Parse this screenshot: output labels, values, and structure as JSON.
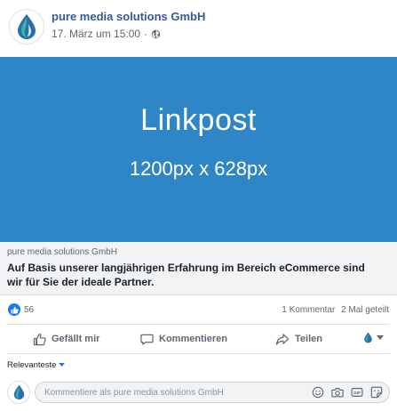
{
  "post": {
    "page_name": "pure media solutions GmbH",
    "timestamp": "17. März um 15:00",
    "privacy_icon": "globe-icon",
    "dot": "·"
  },
  "link_preview": {
    "image_title": "Linkpost",
    "image_size": "1200px x 628px",
    "image_color": "#2f86c6",
    "domain": "pure media solutions GmbH",
    "headline": "Auf Basis unserer langjährigen Erfahrung im Bereich eCommerce sind wir für Sie der ideale Partner."
  },
  "reactions": {
    "like_count": "56",
    "comments": "1 Kommentar",
    "shares": "2 Mal geteilt"
  },
  "actions": {
    "like": "Gefällt mir",
    "comment": "Kommentieren",
    "share": "Teilen"
  },
  "comments": {
    "sort_label": "Relevanteste",
    "placeholder": "Kommentiere als pure media solutions GmbH"
  },
  "colors": {
    "brand_blue": "#365899",
    "accent": "#1877f2",
    "logo_teal": "#1d8a9c"
  }
}
